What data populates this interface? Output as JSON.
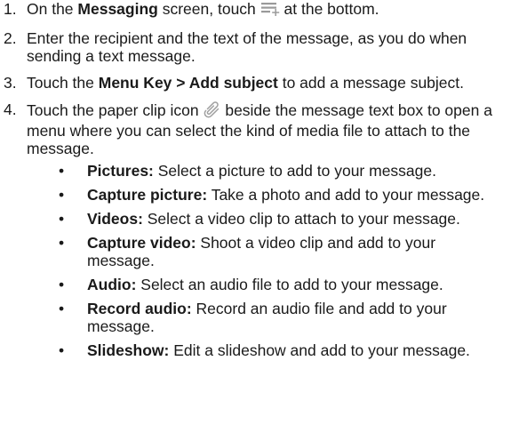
{
  "steps": [
    {
      "number": "1.",
      "text_before": "On the ",
      "bold": "Messaging",
      "text_middle": " screen, touch ",
      "icon": "compose-message-icon",
      "text_after": " at the bottom."
    },
    {
      "number": "2.",
      "text": "Enter the recipient and the text of the message, as you do when sending a text message."
    },
    {
      "number": "3.",
      "text_before": "Touch the ",
      "bold": "Menu Key > Add subject",
      "text_after": " to add a message subject."
    },
    {
      "number": "4.",
      "text_before": "Touch the paper clip icon ",
      "icon": "paperclip-icon",
      "text_after": " beside the message text box to open a menu where you can select the kind of media file to attach to the message."
    }
  ],
  "bullet_symbol": "•",
  "bullets": [
    {
      "label": "Pictures:",
      "text": " Select a picture to add to your message."
    },
    {
      "label": "Capture picture:",
      "text": " Take a photo and add to your message."
    },
    {
      "label": "Videos:",
      "text": " Select a video clip to attach to your message."
    },
    {
      "label": "Capture video:",
      "text": " Shoot a video clip and add to your message."
    },
    {
      "label": "Audio:",
      "text": " Select an audio file to add to your message."
    },
    {
      "label": "Record audio:",
      "text": " Record an audio file and add to your message."
    },
    {
      "label": "Slideshow:",
      "text": " Edit a slideshow and add to your message."
    }
  ]
}
